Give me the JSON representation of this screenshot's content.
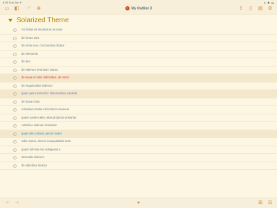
{
  "status": {
    "time": "8:05",
    "date": "Sun Jan 9",
    "indicators": "▲ ◆ ▬"
  },
  "toolbar": {
    "title": "My Outline 3",
    "doc_icon_glyph": "≡",
    "left_icons": [
      "folder-icon",
      "sidebar-icon",
      "undo-icon",
      "redo-icon"
    ],
    "right_icons": [
      "share-icon",
      "format-icon",
      "view-icon",
      "settings-icon"
    ]
  },
  "heading": {
    "text": "Solarized Theme",
    "color": "#b58900"
  },
  "rows": [
    {
      "text": "An finitus sit mundus et an unus",
      "color": "#657b83",
      "highlight": false
    },
    {
      "text": "de forma eius",
      "color": "#657b83",
      "highlight": false
    },
    {
      "text": "de motu eius, cur mundus dicatur",
      "color": "#657b83",
      "highlight": false
    },
    {
      "text": "de elementis",
      "color": "#657b83",
      "highlight": false
    },
    {
      "text": "de deo",
      "color": "#657b83",
      "highlight": false
    },
    {
      "text": "de siderum errantium natura",
      "color": "#657b83",
      "highlight": false
    },
    {
      "text": "de lunae et solis defectibus, de nocte",
      "color": "#dc322f",
      "highlight": true
    },
    {
      "text": "de magnitudine siderum",
      "color": "#657b83",
      "highlight": false
    },
    {
      "text": "quae quis invenerit in observatione caelesti",
      "color": "#6c71c4",
      "highlight": true
    },
    {
      "text": "de lunae motu",
      "color": "#657b83",
      "highlight": false
    },
    {
      "text": "errantium motus et luminum conexus",
      "color": "#657b83",
      "highlight": false
    },
    {
      "text": "quare eadem alter, alias propiora videantur",
      "color": "#657b83",
      "highlight": false
    },
    {
      "text": "catholica siderum errantium",
      "color": "#657b83",
      "highlight": false
    },
    {
      "text": "quae ratio coluros aerum mutet",
      "color": "#268bd2",
      "highlight": true
    },
    {
      "text": "solis motus, dierum inaequalitatis ratio",
      "color": "#657b83",
      "highlight": false
    },
    {
      "text": "quare fulmina Iovi adsignentur",
      "color": "#657b83",
      "highlight": false
    },
    {
      "text": "intervalla siderum",
      "color": "#657b83",
      "highlight": false
    },
    {
      "text": "de sideribus musica",
      "color": "#657b83",
      "highlight": false
    }
  ],
  "bottombar": {
    "left_icons": [
      "outdent-icon",
      "indent-icon"
    ],
    "center_icon": "microphone-icon",
    "right_icons": [
      "new-row-icon",
      "new-child-icon"
    ]
  }
}
